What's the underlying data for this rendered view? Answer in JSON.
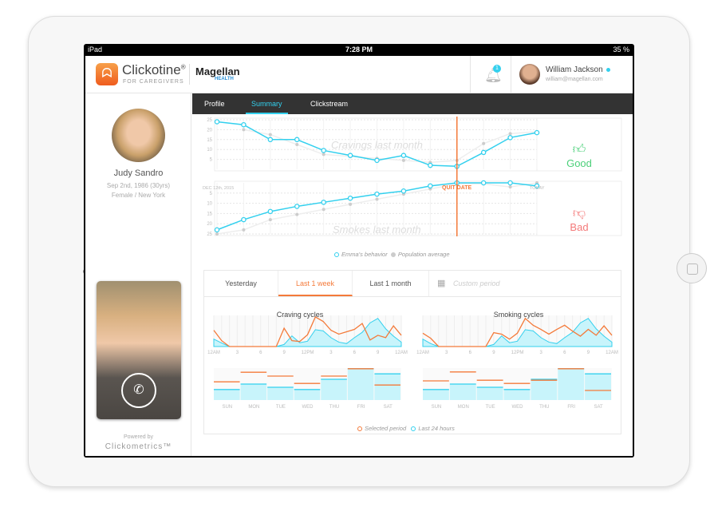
{
  "status_bar": {
    "device": "iPad",
    "time": "7:28 PM",
    "battery": "35 %"
  },
  "header": {
    "app_name": "Clickotine",
    "app_sub": "FOR CAREGIVERS",
    "partner": "Magellan",
    "partner_sub": "HEALTH",
    "notification_count": "1",
    "user_name": "William Jackson",
    "user_email": "william@magellan.com"
  },
  "patient": {
    "name": "Judy Sandro",
    "dob": "Sep 2nd, 1986 (30yrs)",
    "details": "Female / New York",
    "powered_by": "Powered by",
    "powered_brand": "Clickometrics™"
  },
  "tabs": [
    {
      "label": "Profile"
    },
    {
      "label": "Summary",
      "active": true
    },
    {
      "label": "Clickstream"
    }
  ],
  "overview": {
    "good_label": "Good",
    "bad_label": "Bad",
    "start_label": "DEC 12th, 2015",
    "quit_label": "QUIT DATE",
    "today_label": "TODAY",
    "legend_emma": "Emma's behavior",
    "legend_population": "Population average"
  },
  "periods": {
    "items": [
      "Yesterday",
      "Last 1 week",
      "Last 1 month"
    ],
    "active": "Last 1 week",
    "custom_placeholder": "Custom period"
  },
  "cycles": {
    "legend_selected": "Selected period",
    "legend_last24": "Last 24 hours"
  },
  "colors": {
    "cyan": "#33d0ee",
    "orange": "#f47a3a",
    "good": "#4cd07a",
    "bad": "#f47a7a",
    "tabbar": "#333333"
  },
  "chart_data": [
    {
      "type": "line",
      "title": "Cravings last month",
      "yticks": [
        5,
        10,
        15,
        20,
        25
      ],
      "ylim": [
        0,
        25
      ],
      "quit_index": 9,
      "series": [
        {
          "name": "Emma's behavior",
          "values": [
            24,
            22.5,
            15,
            15,
            9.5,
            7,
            4.5,
            7,
            2,
            1.5,
            8.5,
            16,
            18.5
          ]
        },
        {
          "name": "Population average",
          "values": [
            null,
            20,
            17.5,
            12.5,
            7.5,
            6.5,
            5.5,
            4.5,
            3.5,
            4.5,
            13,
            18,
            19
          ]
        }
      ]
    },
    {
      "type": "line",
      "title": "Smokes last month",
      "yticks": [
        5,
        10,
        15,
        20,
        25
      ],
      "ylim": [
        0,
        25
      ],
      "inverted": true,
      "quit_index": 9,
      "series": [
        {
          "name": "Emma's behavior",
          "values": [
            23,
            18,
            14,
            11.5,
            9.5,
            7.5,
            5.5,
            4,
            1.5,
            0,
            0,
            0,
            1.5
          ]
        },
        {
          "name": "Population average",
          "values": [
            25,
            23,
            18,
            15.5,
            13,
            10.5,
            8,
            5.5,
            3,
            0.5,
            0.5,
            2,
            0
          ]
        }
      ]
    },
    {
      "type": "area",
      "title": "Craving cycles",
      "xticks": [
        "12AM",
        "3",
        "6",
        "9",
        "12PM",
        "3",
        "6",
        "9",
        "12AM"
      ],
      "series": [
        {
          "name": "Selected period",
          "values": [
            0.55,
            0.2,
            0,
            0,
            0,
            0,
            0,
            0,
            0,
            0.62,
            0.2,
            0.17,
            0.4,
            1,
            0.85,
            0.55,
            0.42,
            0.5,
            0.58,
            0.78,
            0.22,
            0.38,
            0.3,
            0.7,
            0.38
          ]
        },
        {
          "name": "Last 24 hours",
          "values": [
            0.25,
            0.12,
            0,
            0,
            0,
            0,
            0,
            0,
            0,
            0.07,
            0.36,
            0.13,
            0.18,
            0.57,
            0.53,
            0.3,
            0.15,
            0.1,
            0.3,
            0.48,
            0.8,
            0.95,
            0.6,
            0.35,
            0.15
          ]
        }
      ]
    },
    {
      "type": "bar",
      "title": "",
      "categories": [
        "SUN",
        "MON",
        "TUE",
        "WED",
        "THU",
        "FRI",
        "SAT"
      ],
      "series": [
        {
          "name": "Selected period",
          "values": [
            0.57,
            0.87,
            0.75,
            0.52,
            0.75,
            0.98,
            0.47
          ]
        },
        {
          "name": "Last 24 hours",
          "values": [
            0.33,
            0.5,
            0.4,
            0.33,
            0.65,
            0.98,
            0.82
          ]
        }
      ]
    },
    {
      "type": "area",
      "title": "Smoking cycles",
      "xticks": [
        "12AM",
        "3",
        "6",
        "9",
        "12PM",
        "3",
        "6",
        "9",
        "12AM"
      ],
      "series": [
        {
          "name": "Selected period",
          "values": [
            0.45,
            0.28,
            0,
            0,
            0,
            0,
            0,
            0,
            0,
            0.47,
            0.42,
            0.25,
            0.45,
            0.95,
            0.72,
            0.58,
            0.42,
            0.58,
            0.72,
            0.52,
            0.35,
            0.58,
            0.38,
            0.7,
            0.38
          ]
        },
        {
          "name": "Last 24 hours",
          "values": [
            0.25,
            0.1,
            0,
            0,
            0,
            0,
            0,
            0,
            0,
            0.07,
            0.36,
            0.13,
            0.18,
            0.57,
            0.53,
            0.3,
            0.15,
            0.1,
            0.3,
            0.48,
            0.8,
            0.95,
            0.6,
            0.35,
            0.15
          ]
        }
      ]
    },
    {
      "type": "bar",
      "title": "",
      "categories": [
        "SUN",
        "MON",
        "TUE",
        "WED",
        "THU",
        "FRI",
        "SAT"
      ],
      "series": [
        {
          "name": "Selected period",
          "values": [
            0.6,
            0.88,
            0.62,
            0.52,
            0.62,
            0.98,
            0.3
          ]
        },
        {
          "name": "Last 24 hours",
          "values": [
            0.33,
            0.5,
            0.4,
            0.33,
            0.65,
            0.98,
            0.82
          ]
        }
      ]
    }
  ]
}
